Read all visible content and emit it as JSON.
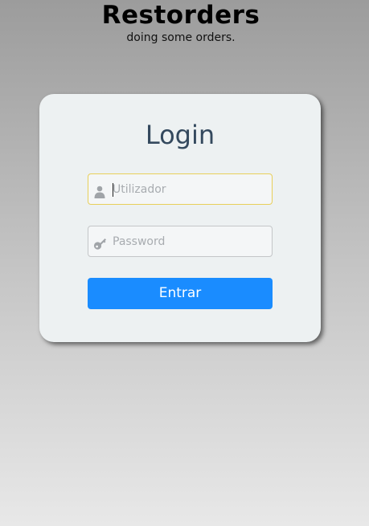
{
  "header": {
    "title": "Restorders",
    "subtitle": "doing some orders."
  },
  "login": {
    "heading": "Login",
    "username": {
      "value": "",
      "placeholder": "Utilizador",
      "icon": "user-icon",
      "focused": true
    },
    "password": {
      "value": "",
      "placeholder": "Password",
      "icon": "key-icon"
    },
    "submit_label": "Entrar"
  },
  "colors": {
    "button": "#1a8cff",
    "heading": "#34495e",
    "card": "#edf1f2",
    "focus_border": "#e8cf5a"
  }
}
